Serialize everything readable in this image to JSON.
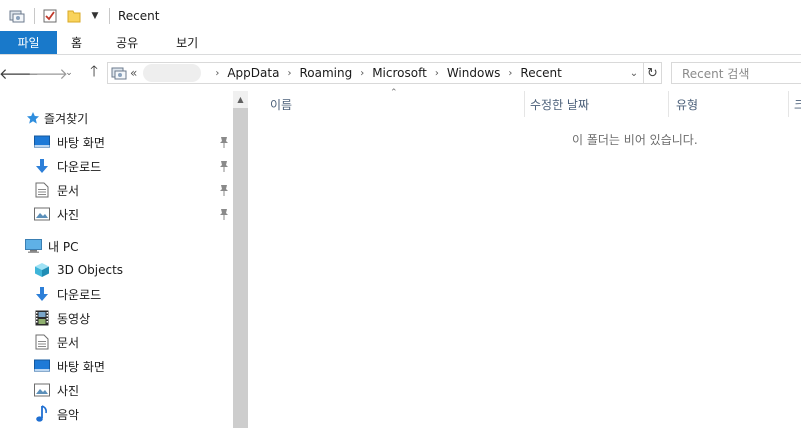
{
  "window": {
    "title": "Recent"
  },
  "ribbon": {
    "tabs": [
      {
        "label": "파일",
        "active": true
      },
      {
        "label": "홈"
      },
      {
        "label": "공유"
      },
      {
        "label": "보기"
      }
    ]
  },
  "address": {
    "overflow": "«",
    "crumbs": [
      "AppData",
      "Roaming",
      "Microsoft",
      "Windows",
      "Recent"
    ]
  },
  "search": {
    "placeholder": "Recent 검색"
  },
  "nav": {
    "quick_access": "즐겨찾기",
    "quick_items": [
      "바탕 화면",
      "다운로드",
      "문서",
      "사진"
    ],
    "this_pc": "내 PC",
    "pc_items": [
      "3D Objects",
      "다운로드",
      "동영상",
      "문서",
      "바탕 화면",
      "사진",
      "음악"
    ]
  },
  "columns": {
    "name": "이름",
    "date": "수정한 날짜",
    "type": "유형",
    "size": "크"
  },
  "content": {
    "empty_message": "이 폴더는 비어 있습니다."
  },
  "colors": {
    "accent": "#1979ca",
    "header_text": "#4c607a"
  }
}
